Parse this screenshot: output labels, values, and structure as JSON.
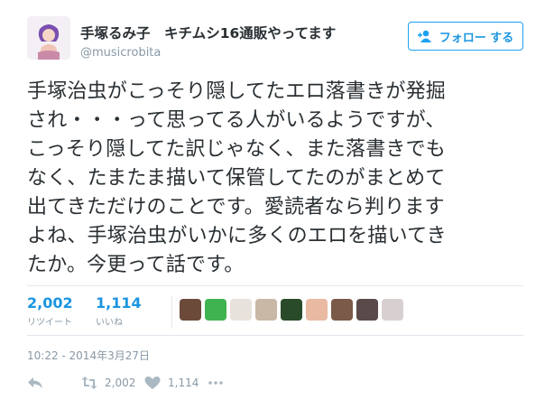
{
  "user": {
    "display_name": "手塚るみ子　キチムシ16通販やってます",
    "handle": "@musicrobita",
    "avatar_icon": "user-avatar-illustration"
  },
  "follow_button": {
    "label": "フォロー する",
    "icon": "follow-user-icon"
  },
  "tweet": {
    "lines": [
      "手塚治虫がこっそり隠してたエロ落書きが発掘",
      "され・・・って思ってる人がいるようですが、",
      "こっそり隠してた訳じゃなく、また落書きでも",
      "なく、たまたま描いて保管してたのがまとめて",
      "出てきただけのことです。愛読者なら判ります",
      "よね、手塚治虫がいかに多くのエロを描いてき",
      "たか。今更って話です。"
    ]
  },
  "stats": {
    "retweets": {
      "count": "2,002",
      "label": "リツイート"
    },
    "likes": {
      "count": "1,114",
      "label": "いいね"
    }
  },
  "likers_count_shown": 9,
  "timestamp": "10:22 - 2014年3月27日",
  "actions": {
    "reply_icon": "reply-icon",
    "retweet": {
      "icon": "retweet-icon",
      "count": "2,002"
    },
    "like": {
      "icon": "heart-icon",
      "count": "1,114"
    },
    "more_icon": "more-icon"
  },
  "colors": {
    "accent": "#1da1f2",
    "text": "#292f33",
    "muted": "#8899a6",
    "border": "#e1e8ed"
  }
}
